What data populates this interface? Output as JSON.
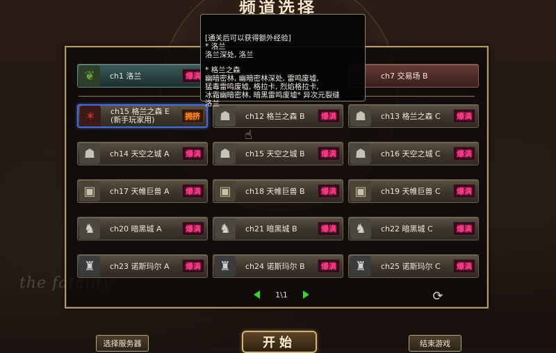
{
  "window": {
    "title": "频道选择"
  },
  "brand_watermark": "the fatality",
  "tooltip": {
    "lines": [
      "[通关后可以获得额外经验]",
      "* 洛兰",
      "洛兰深处, 洛兰",
      "",
      "* 格兰之森",
      "幽暗密林, 幽暗密林深处, 雷鸣废墟,",
      "猛毒雷鸣废墟, 格拉卡, 烈焰格拉卡,",
      "冰霜幽暗密林, 暗黑雷鸣废墟* 异次元裂缝",
      "洛兰"
    ]
  },
  "top_row": [
    {
      "label": "ch1 洛兰",
      "badge": "爆满",
      "icon": "leaf-icon"
    },
    {
      "label": "ch7 交易场 B",
      "badge": "",
      "icon": "none"
    }
  ],
  "channels": [
    {
      "label": "ch15 格兰之森 E",
      "sub": "(新手玩家用)",
      "badge": "拥挤",
      "icon": "imp-icon",
      "selected": true
    },
    {
      "label": "ch12 格兰之森 B",
      "badge": "爆满",
      "icon": "goblin-icon"
    },
    {
      "label": "ch13 格兰之森 C",
      "badge": "爆满",
      "icon": "goblin-icon"
    },
    {
      "label": "ch14 天空之城 A",
      "badge": "爆满",
      "icon": "goblin-icon"
    },
    {
      "label": "ch15 天空之城 B",
      "badge": "爆满",
      "icon": "goblin-icon"
    },
    {
      "label": "ch16 天空之城 C",
      "badge": "爆满",
      "icon": "goblin-icon"
    },
    {
      "label": "ch17 天帷巨兽 A",
      "badge": "爆满",
      "icon": "box-icon"
    },
    {
      "label": "ch18 天帷巨兽 B",
      "badge": "爆满",
      "icon": "box-icon"
    },
    {
      "label": "ch19 天帷巨兽 C",
      "badge": "爆满",
      "icon": "box-icon"
    },
    {
      "label": "ch20 暗黑城 A",
      "badge": "爆满",
      "icon": "tau-icon"
    },
    {
      "label": "ch21 暗黑城 B",
      "badge": "爆满",
      "icon": "tau-icon"
    },
    {
      "label": "ch22 暗黑城 C",
      "badge": "爆满",
      "icon": "tau-icon"
    },
    {
      "label": "ch23 诺斯玛尔 A",
      "badge": "爆满",
      "icon": "knight-icon"
    },
    {
      "label": "ch24 诺斯玛尔 B",
      "badge": "爆满",
      "icon": "knight-icon"
    },
    {
      "label": "ch25 诺斯玛尔 C",
      "badge": "爆满",
      "icon": "knight-icon"
    }
  ],
  "pager": {
    "text": "1\\1"
  },
  "buttons": {
    "left": "选择服务器",
    "start": "开始",
    "right": "结束游戏"
  },
  "colors": {
    "badge_full": "#ff3d8a",
    "badge_busy": "#ff8a2a",
    "accent_select": "#4a6ccf",
    "pager_arrow": "#3bd32e"
  }
}
